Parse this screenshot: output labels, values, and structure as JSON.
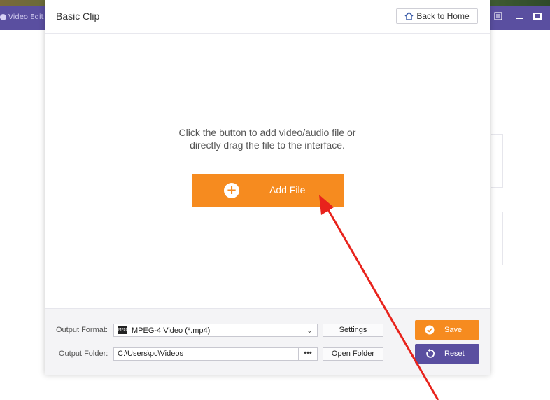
{
  "background_app": {
    "title": "Video Edit",
    "accent": "#5a4fa0"
  },
  "dialog": {
    "title": "Basic Clip",
    "back_button": "Back to Home",
    "hint_line1": "Click the button to add video/audio file or",
    "hint_line2": "directly drag the file to the interface.",
    "add_file": "Add File",
    "accent_orange": "#f68b1f"
  },
  "footer": {
    "output_format_label": "Output Format:",
    "output_format_value": "MPEG-4 Video (*.mp4)",
    "format_icon_text": "MPEG",
    "settings_button": "Settings",
    "output_folder_label": "Output Folder:",
    "output_folder_value": "C:\\Users\\pc\\Videos",
    "browse_button": "•••",
    "open_folder_button": "Open Folder",
    "save_button": "Save",
    "reset_button": "Reset",
    "save_color": "#f68b1f",
    "reset_color": "#5a4fa0"
  },
  "annotation": {
    "arrow_color": "#e8231c"
  }
}
